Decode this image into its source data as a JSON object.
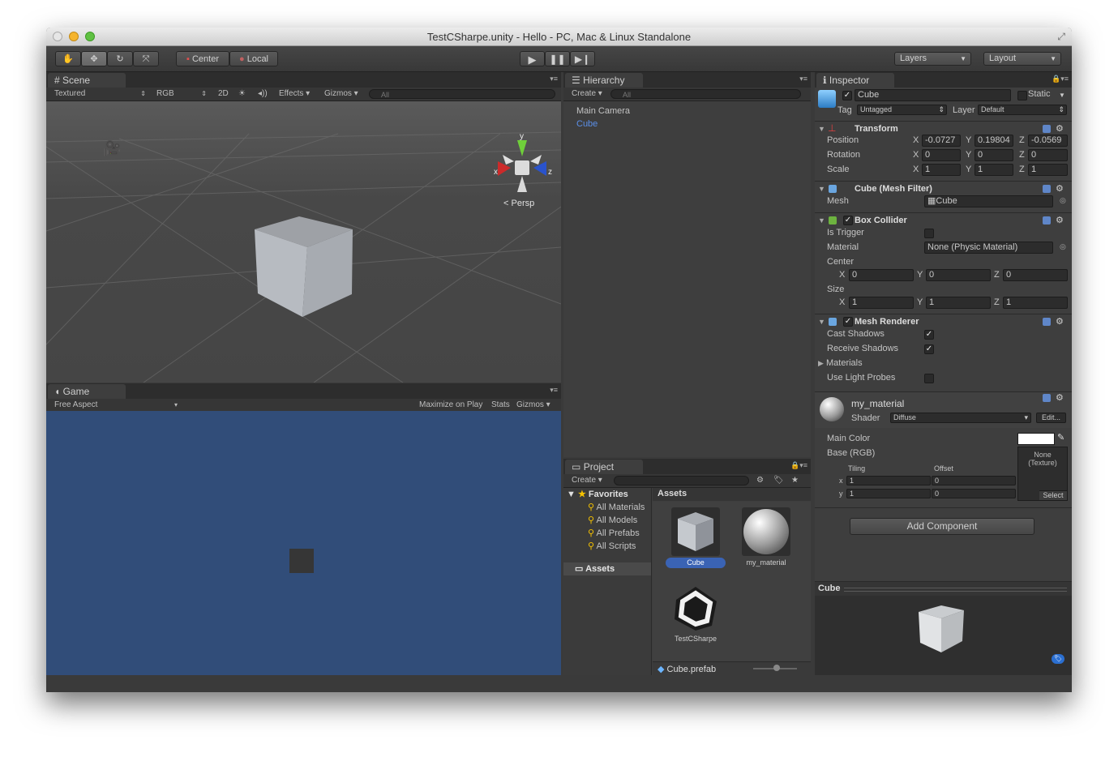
{
  "window": {
    "title": "TestCSharpe.unity - Hello - PC, Mac & Linux Standalone"
  },
  "toolbar": {
    "center_label": "Center",
    "local_label": "Local",
    "layers_label": "Layers",
    "layout_label": "Layout"
  },
  "scene": {
    "tab_label": "Scene",
    "render_mode": "Textured",
    "color_mode": "RGB",
    "mode_2d": "2D",
    "effects_label": "Effects",
    "gizmos_label": "Gizmos",
    "search_placeholder": "All",
    "persp_label": "Persp",
    "axis_y": "y",
    "axis_x": "x",
    "axis_z": "z"
  },
  "game": {
    "tab_label": "Game",
    "aspect": "Free Aspect",
    "maximize_label": "Maximize on Play",
    "stats_label": "Stats",
    "gizmos_label": "Gizmos"
  },
  "hierarchy": {
    "tab_label": "Hierarchy",
    "create_label": "Create",
    "search_placeholder": "All",
    "items": [
      "Main Camera",
      "Cube"
    ]
  },
  "project": {
    "tab_label": "Project",
    "create_label": "Create",
    "favorites_label": "Favorites",
    "favorites": [
      "All Materials",
      "All Models",
      "All Prefabs",
      "All Scripts"
    ],
    "assets_tree_label": "Assets",
    "assets_header": "Assets",
    "asset_items": [
      "Cube",
      "my_material",
      "TestCSharpe"
    ],
    "footer_label": "Cube.prefab"
  },
  "inspector": {
    "tab_label": "Inspector",
    "object_name": "Cube",
    "static_label": "Static",
    "tag_label": "Tag",
    "tag_value": "Untagged",
    "layer_label": "Layer",
    "layer_value": "Default",
    "transform": {
      "title": "Transform",
      "position_label": "Position",
      "rotation_label": "Rotation",
      "scale_label": "Scale",
      "x_label": "X",
      "y_label": "Y",
      "z_label": "Z",
      "position": [
        "-0.0727",
        "0.19804",
        "-0.0569"
      ],
      "rotation": [
        "0",
        "0",
        "0"
      ],
      "scale": [
        "1",
        "1",
        "1"
      ]
    },
    "mesh_filter": {
      "title": "Cube (Mesh Filter)",
      "mesh_label": "Mesh",
      "mesh_value": "Cube"
    },
    "box_collider": {
      "title": "Box Collider",
      "is_trigger_label": "Is Trigger",
      "material_label": "Material",
      "material_value": "None (Physic Material)",
      "center_label": "Center",
      "size_label": "Size",
      "center": [
        "0",
        "0",
        "0"
      ],
      "size": [
        "1",
        "1",
        "1"
      ]
    },
    "mesh_renderer": {
      "title": "Mesh Renderer",
      "cast_shadows_label": "Cast Shadows",
      "receive_shadows_label": "Receive Shadows",
      "materials_label": "Materials",
      "light_probes_label": "Use Light Probes"
    },
    "material": {
      "name": "my_material",
      "shader_label": "Shader",
      "shader_value": "Diffuse",
      "edit_label": "Edit...",
      "main_color_label": "Main Color",
      "base_label": "Base (RGB)",
      "tiling_label": "Tiling",
      "offset_label": "Offset",
      "x_label": "x",
      "y_label": "y",
      "tiling": [
        "1",
        "1"
      ],
      "offset": [
        "0",
        "0"
      ],
      "texture_none": "None\n(Texture)",
      "select_label": "Select"
    },
    "add_component_label": "Add Component",
    "preview_title": "Cube"
  }
}
